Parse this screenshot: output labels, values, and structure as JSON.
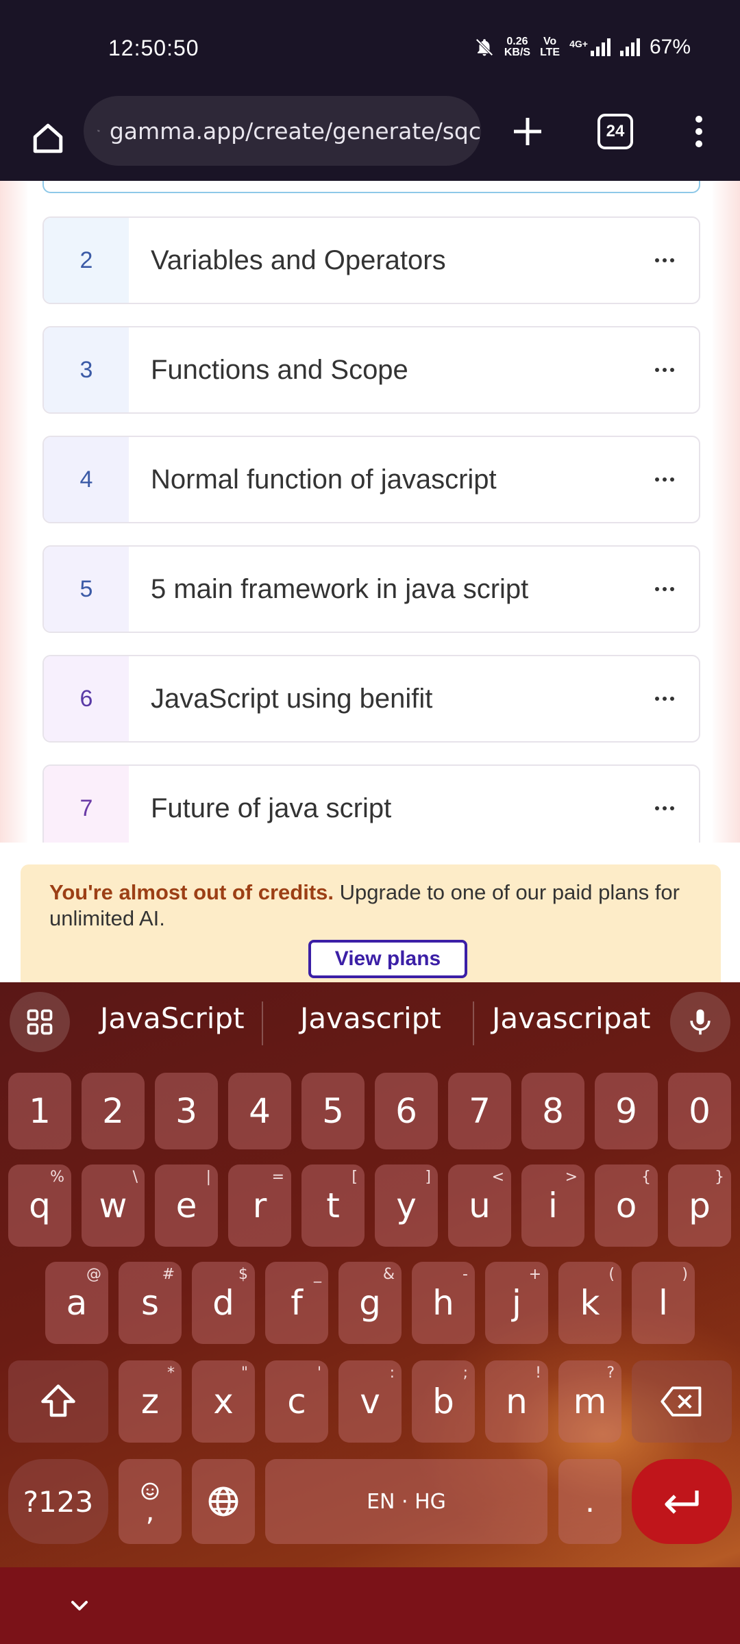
{
  "status": {
    "time": "12:50:50",
    "net_speed_top": "0.26",
    "net_speed_bottom": "KB/S",
    "volte_top": "Vo",
    "volte_bottom": "LTE",
    "network": "4G+",
    "battery": "67%"
  },
  "browser": {
    "url": "gamma.app/create/generate/sqc",
    "tab_count": "24"
  },
  "outline": {
    "items": [
      {
        "num": "2",
        "title": "Variables and Operators"
      },
      {
        "num": "3",
        "title": "Functions and Scope"
      },
      {
        "num": "4",
        "title": "Normal function of javascript"
      },
      {
        "num": "5",
        "title": "5 main framework in java script"
      },
      {
        "num": "6",
        "title": "JavaScript using benifit"
      },
      {
        "num": "7",
        "title": "Future of java script"
      }
    ]
  },
  "banner": {
    "strong": "You're almost out of credits.",
    "text": " Upgrade to one of our paid plans for unlimited AI.",
    "button": "View plans"
  },
  "keyboard": {
    "suggestions": [
      "JavaScript",
      "Javascript",
      "Javascripat"
    ],
    "numbers": [
      "1",
      "2",
      "3",
      "4",
      "5",
      "6",
      "7",
      "8",
      "9",
      "0"
    ],
    "row1": [
      {
        "k": "q",
        "s": "%"
      },
      {
        "k": "w",
        "s": "\\"
      },
      {
        "k": "e",
        "s": "|"
      },
      {
        "k": "r",
        "s": "="
      },
      {
        "k": "t",
        "s": "["
      },
      {
        "k": "y",
        "s": "]"
      },
      {
        "k": "u",
        "s": "<"
      },
      {
        "k": "i",
        "s": ">"
      },
      {
        "k": "o",
        "s": "{"
      },
      {
        "k": "p",
        "s": "}"
      }
    ],
    "row2": [
      {
        "k": "a",
        "s": "@"
      },
      {
        "k": "s",
        "s": "#"
      },
      {
        "k": "d",
        "s": "$"
      },
      {
        "k": "f",
        "s": "_"
      },
      {
        "k": "g",
        "s": "&"
      },
      {
        "k": "h",
        "s": "-"
      },
      {
        "k": "j",
        "s": "+"
      },
      {
        "k": "k",
        "s": "("
      },
      {
        "k": "l",
        "s": ")"
      }
    ],
    "row3": [
      {
        "k": "z",
        "s": "*"
      },
      {
        "k": "x",
        "s": "\""
      },
      {
        "k": "c",
        "s": "'"
      },
      {
        "k": "v",
        "s": ":"
      },
      {
        "k": "b",
        "s": ";"
      },
      {
        "k": "n",
        "s": "!"
      },
      {
        "k": "m",
        "s": "?"
      }
    ],
    "symbols_key": "?123",
    "comma": ",",
    "space_label": "EN · HG",
    "period": "."
  }
}
